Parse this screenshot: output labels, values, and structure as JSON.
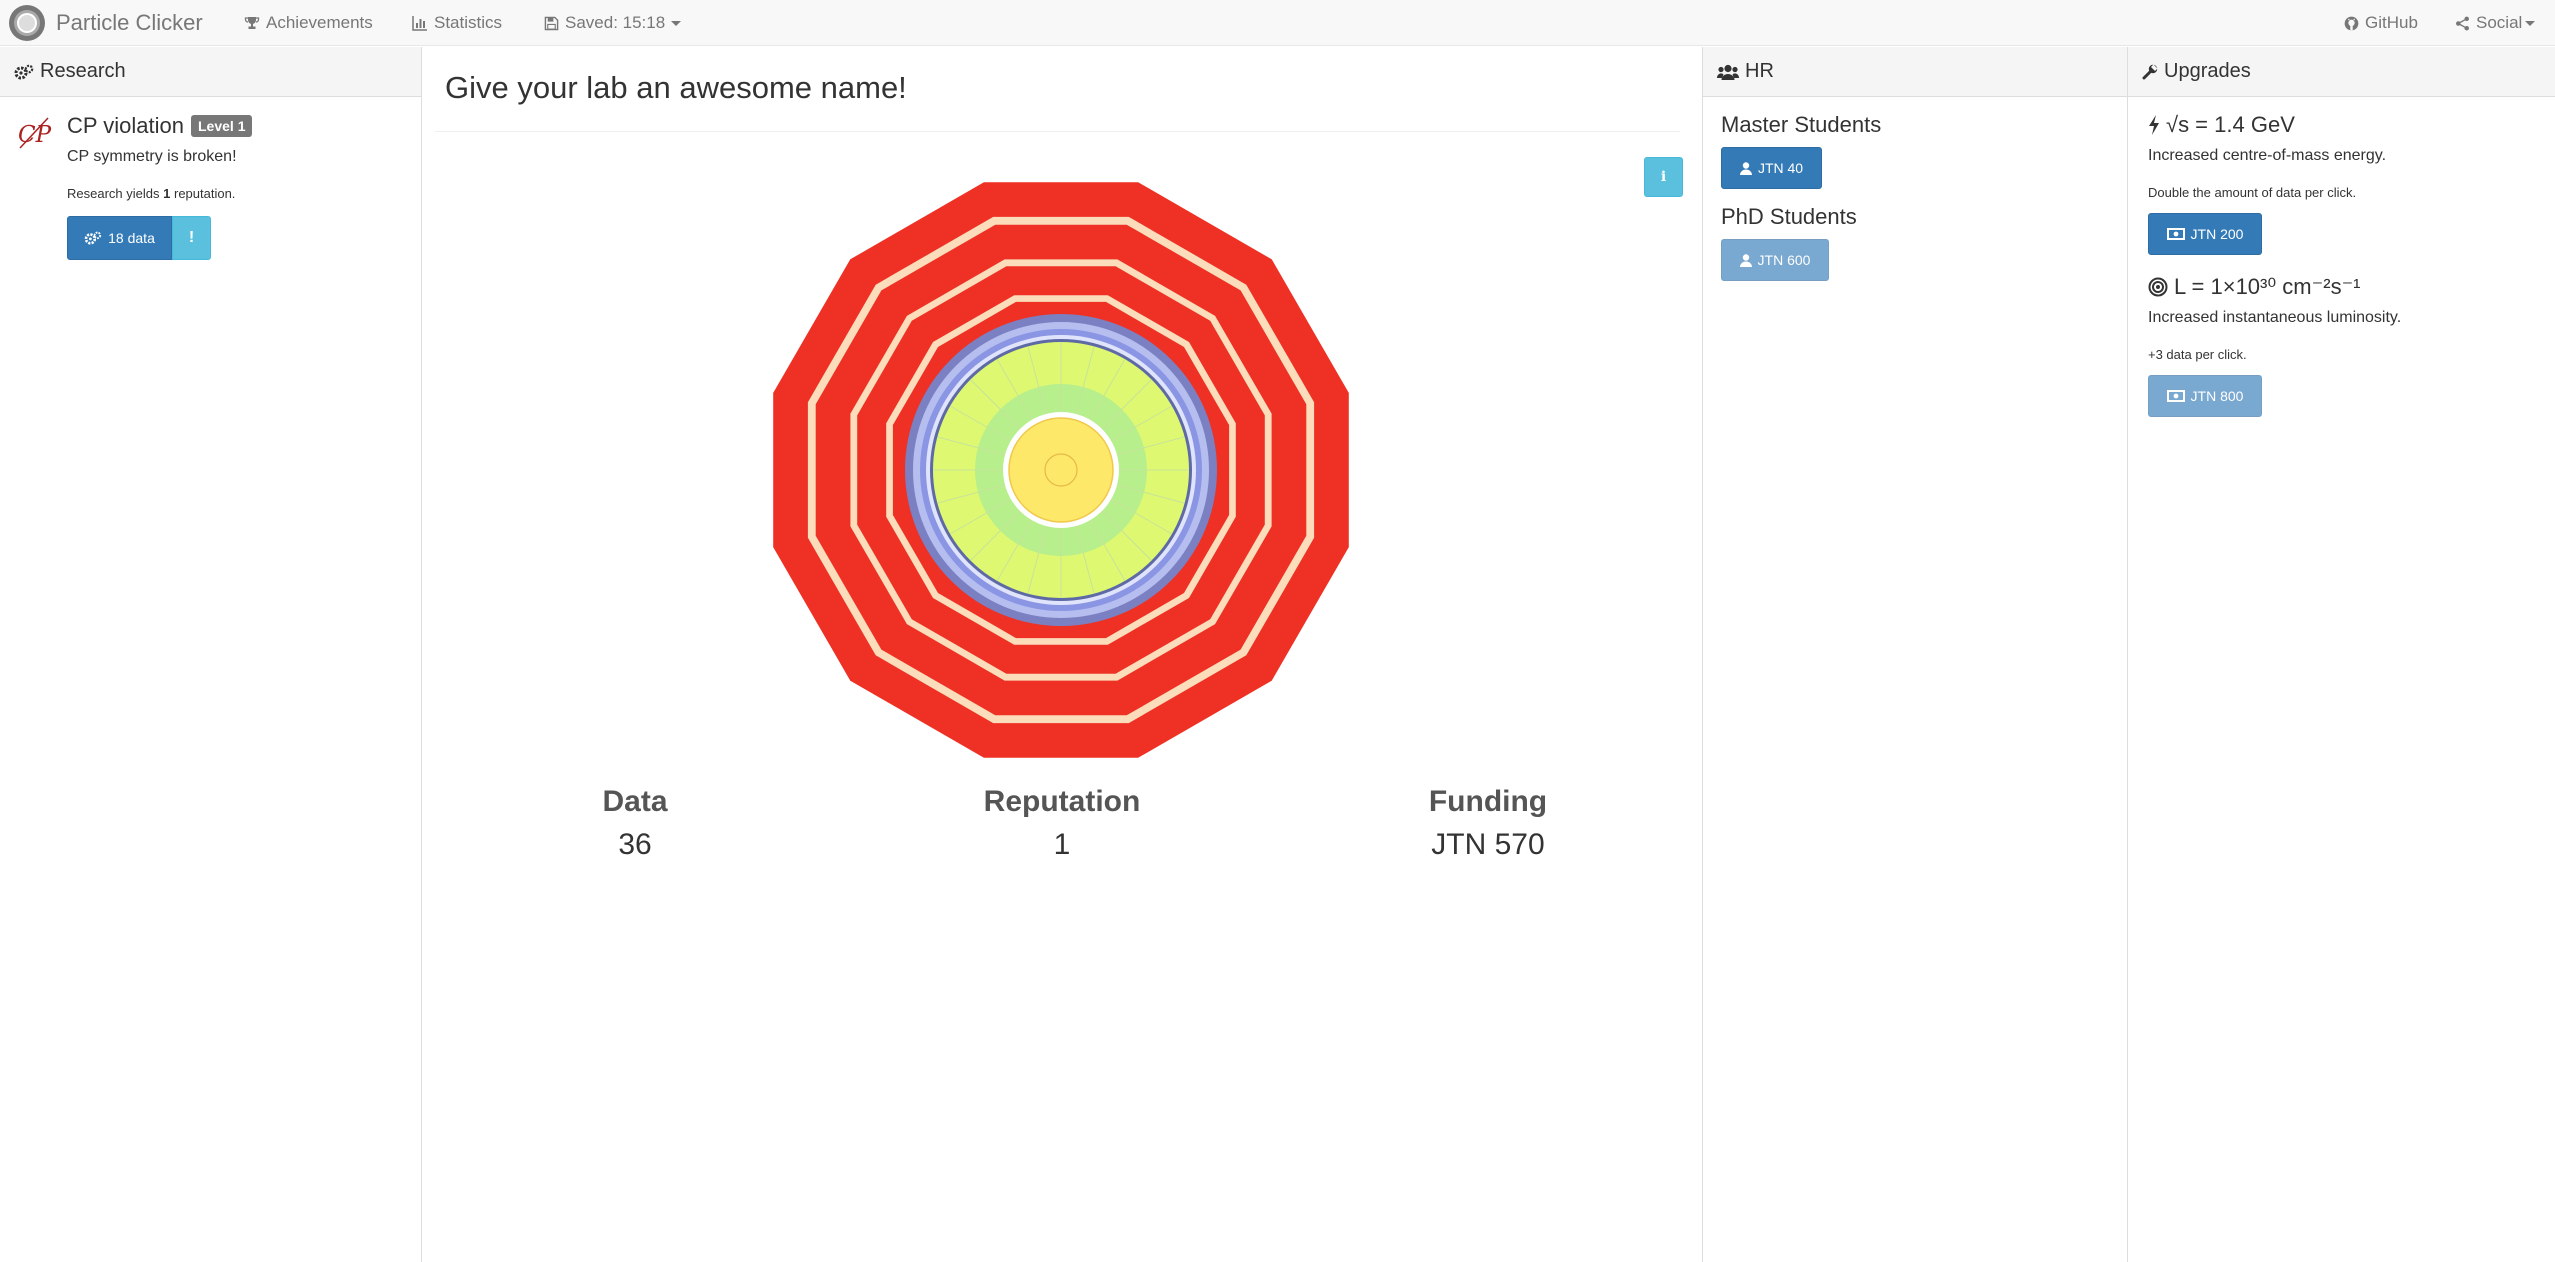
{
  "navbar": {
    "brand": "Particle Clicker",
    "achievements": "Achievements",
    "statistics": "Statistics",
    "saved": "Saved: 15:18",
    "github": "GitHub",
    "social": "Social"
  },
  "research": {
    "header": "Research",
    "item": {
      "title": "CP violation",
      "level": "Level 1",
      "description": "CP symmetry is broken!",
      "yield_prefix": "Research yields",
      "yield_value": "1",
      "yield_suffix": "reputation.",
      "button_label": "18 data",
      "info_glyph": "!"
    }
  },
  "center": {
    "lab_name": "Give your lab an awesome name!",
    "info_glyph": "i",
    "stats": [
      {
        "label": "Data",
        "value": "36"
      },
      {
        "label": "Reputation",
        "value": "1"
      },
      {
        "label": "Funding",
        "value": "JTN 570"
      }
    ]
  },
  "hr": {
    "header": "HR",
    "items": [
      {
        "name": "Master Students",
        "cost": "JTN 40",
        "enabled": true
      },
      {
        "name": "PhD Students",
        "cost": "JTN 600",
        "enabled": false
      }
    ]
  },
  "upgrades": {
    "header": "Upgrades",
    "items": [
      {
        "name": "√s = 1.4 GeV",
        "description": "Increased centre-of-mass energy.",
        "detail": "Double the amount of data per click.",
        "cost": "JTN 200",
        "enabled": true
      },
      {
        "name": "L = 1×10³⁰ cm⁻²s⁻¹",
        "description": "Increased instantaneous luminosity.",
        "detail": "+3 data per click.",
        "cost": "JTN 800",
        "enabled": false
      }
    ]
  },
  "colors": {
    "primary": "#337ab7",
    "info": "#5bc0de",
    "muon_red": "#ee3124",
    "ring_cream": "#fbdcbb",
    "hcal_blue": "#7a80c2",
    "ecal_green": "#dff871",
    "tracker_yellow": "#fde869"
  }
}
